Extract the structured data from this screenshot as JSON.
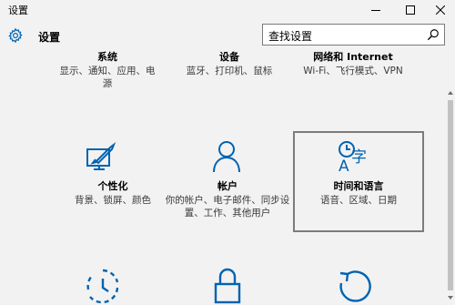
{
  "window": {
    "title": "设置",
    "controls": [
      "minimize",
      "maximize",
      "close"
    ]
  },
  "header": {
    "icon": "gear-icon",
    "title": "设置"
  },
  "search": {
    "value": "查找设置",
    "icon": "search-icon"
  },
  "tiles": [
    {
      "id": "system",
      "title": "系统",
      "desc": "显示、通知、应用、电源"
    },
    {
      "id": "devices",
      "title": "设备",
      "desc": "蓝牙、打印机、鼠标"
    },
    {
      "id": "network",
      "title": "网络和 Internet",
      "desc": "Wi-Fi、飞行模式、VPN"
    },
    {
      "id": "personalization",
      "icon": "personalization-icon",
      "title": "个性化",
      "desc": "背景、锁屏、颜色"
    },
    {
      "id": "accounts",
      "icon": "account-person-icon",
      "title": "帐户",
      "desc": "你的帐户、电子邮件、同步设置、工作、其他用户"
    },
    {
      "id": "time-language",
      "icon": "time-language-icon",
      "title": "时间和语言",
      "desc": "语音、区域、日期",
      "selected": true
    },
    {
      "id": "ease-of-access",
      "icon": "ease-of-access-icon"
    },
    {
      "id": "privacy",
      "icon": "lock-icon"
    },
    {
      "id": "update-security",
      "icon": "update-refresh-icon"
    }
  ],
  "colors": {
    "accent": "#0063b1",
    "background": "#f2f2f2",
    "selection_border": "#7c7c7c"
  }
}
